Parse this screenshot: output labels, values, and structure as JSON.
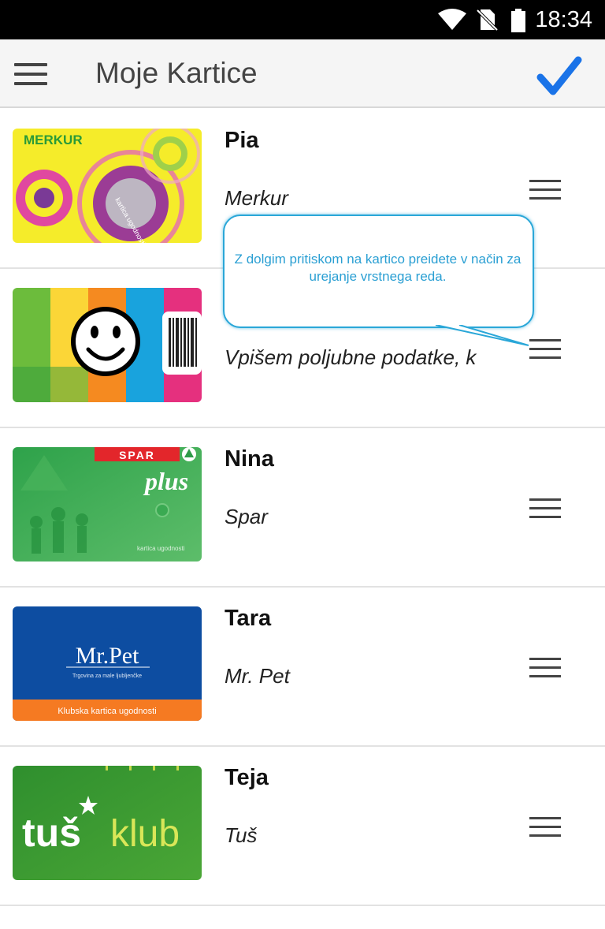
{
  "status_bar": {
    "time": "18:34",
    "icons": [
      "wifi-icon",
      "no-sim-icon",
      "battery-icon"
    ]
  },
  "app_bar": {
    "title": "Moje Kartice",
    "menu_icon": "hamburger-menu-icon",
    "confirm_icon": "checkmark-icon"
  },
  "colors": {
    "accent": "#1a73e8",
    "tooltip": "#2a9fd3"
  },
  "cards": [
    {
      "name": "Pia",
      "store": "Merkur",
      "card_text": "MERKUR",
      "card_subtext": "kartica ugodnosti"
    },
    {
      "name": "",
      "store": "Vpišem poljubne podatke, k",
      "card_text": ""
    },
    {
      "name": "Nina",
      "store": "Spar",
      "card_text": "SPAR",
      "card_subtext": "plus",
      "card_footer": "kartica ugodnosti"
    },
    {
      "name": "Tara",
      "store": "Mr. Pet",
      "card_text": "Mr.Pet",
      "card_subtext": "Trgovina za male ljubljenčke",
      "card_footer": "Klubska kartica ugodnosti"
    },
    {
      "name": "Teja",
      "store": "Tuš",
      "card_text": "tuš",
      "card_subtext": "klub"
    }
  ],
  "tooltip": {
    "text": "Z dolgim pritiskom na kartico preidete v način za urejanje vrstnega reda."
  }
}
